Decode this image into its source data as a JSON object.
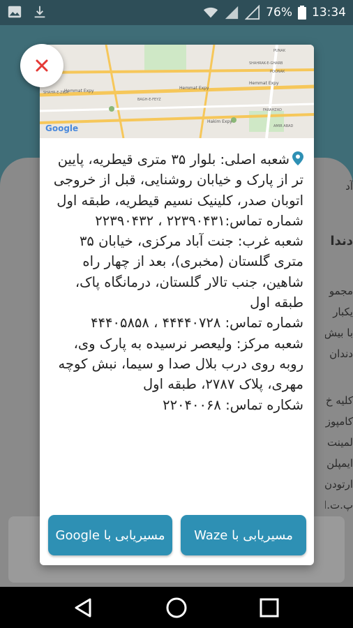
{
  "status_bar": {
    "battery": "76%",
    "time": "13:34",
    "icons": [
      "image-icon",
      "download-icon",
      "wifi-icon",
      "signal-icon",
      "battery-icon"
    ]
  },
  "background_partial_text": [
    "آد",
    "دندا",
    "مجمو",
    "یکبار",
    "با بیش",
    "دندان",
    "کلیه خ",
    "کامپوز",
    "لمینت",
    "ایمپلن",
    "ارتودن",
    "پ.ت.ا"
  ],
  "dialog": {
    "branches": [
      {
        "address": "شعبه اصلی: بلوار ۳۵ متری قیطریه، پایین تر از پارک و خیابان روشنایی، قبل از خروجی اتوبان صدر، کلینیک نسیم قیطریه، طبقه اول",
        "phone": "شماره تماس:۲۲۳۹۰۴۳۱ ، ۲۲۳۹۰۴۳۲"
      },
      {
        "address": "شعبه غرب: جنت آباد مرکزی، خیابان ۳۵ متری گلستان (مخبری)، بعد از چهار راه شاهین، جنب تالار گلستان، درمانگاه پاک، طبقه اول",
        "phone": "شماره تماس: ۴۴۴۴۰۷۲۸ ، ۴۴۴۰۵۸۵۸"
      },
      {
        "address": "شعبه مرکز: ولیعصر نرسیده به پارک وی، روبه روی درب بلال صدا و سیما، نبش کوچه مهری، پلاک ۲۷۸۷، طبقه اول",
        "phone": "شکاره تماس: ۲۲۰۴۰۰۶۸"
      }
    ],
    "waze_button": "مسیریابی با Waze",
    "google_button": "مسیریابی با Google"
  },
  "map": {
    "brand": "Google",
    "labels": [
      "Hemmat Expy",
      "Hemmat Expy",
      "Hemmat Expy",
      "Hakim Expy",
      "SHAHRAK-E-GHARB",
      "SHAHR-E-ZIBA",
      "BAGH-E-FEYZ",
      "AMIR ABAD",
      "FARAHZAD",
      "PUNAK",
      "POONAK"
    ]
  },
  "colors": {
    "accent": "#2e90b4",
    "close": "#e53935",
    "status_bar": "#2e4e58"
  }
}
